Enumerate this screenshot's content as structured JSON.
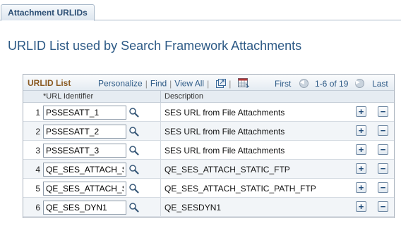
{
  "tab": {
    "label": "Attachment URLIDs"
  },
  "page_title": "URLID List used by Search Framework Attachments",
  "grid": {
    "title": "URLID List",
    "links": {
      "personalize": "Personalize",
      "find": "Find",
      "view_all": "View All"
    },
    "pager": {
      "first": "First",
      "range": "1-6 of 19",
      "last": "Last"
    },
    "columns": {
      "url_identifier": "*URL Identifier",
      "description": "Description"
    },
    "rows": [
      {
        "num": "1",
        "url_id": "PSSESATT_1",
        "description": "SES URL from File Attachments"
      },
      {
        "num": "2",
        "url_id": "PSSESATT_2",
        "description": "SES URL from File Attachments"
      },
      {
        "num": "3",
        "url_id": "PSSESATT_3",
        "description": "SES URL from File Attachments"
      },
      {
        "num": "4",
        "url_id": "QE_SES_ATTACH_S",
        "description": "QE_SES_ATTACH_STATIC_FTP"
      },
      {
        "num": "5",
        "url_id": "QE_SES_ATTACH_S",
        "description": "QE_SES_ATTACH_STATIC_PATH_FTP"
      },
      {
        "num": "6",
        "url_id": "QE_SES_DYN1",
        "description": "QE_SESDYN1"
      }
    ],
    "row_buttons": {
      "add": "+",
      "delete": "−"
    }
  },
  "icons": {
    "zoom": "zoom-icon",
    "download": "download-spreadsheet-icon",
    "prev": "previous-icon",
    "next": "next-icon",
    "lookup": "magnifier-icon"
  },
  "colors": {
    "title": "#2d5a86",
    "grid_title": "#8a5a22",
    "link": "#2d5a86"
  }
}
